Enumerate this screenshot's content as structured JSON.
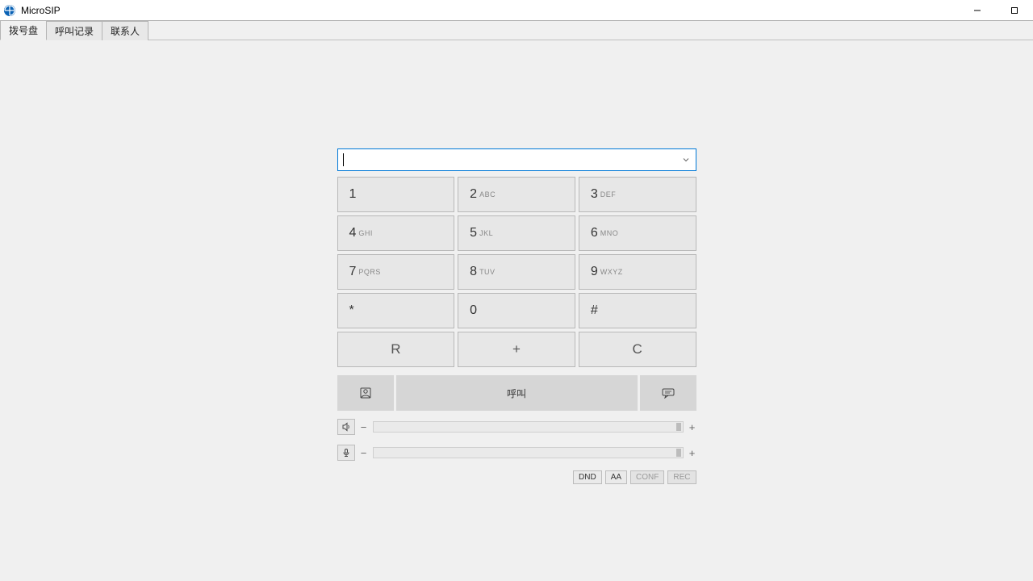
{
  "window": {
    "title": "MicroSIP"
  },
  "tabs": {
    "dialpad": "拨号盘",
    "call_log": "呼叫记录",
    "contacts": "联系人"
  },
  "dialer": {
    "number_value": "",
    "keys": {
      "k1": {
        "digit": "1",
        "letters": ""
      },
      "k2": {
        "digit": "2",
        "letters": "ABC"
      },
      "k3": {
        "digit": "3",
        "letters": "DEF"
      },
      "k4": {
        "digit": "4",
        "letters": "GHI"
      },
      "k5": {
        "digit": "5",
        "letters": "JKL"
      },
      "k6": {
        "digit": "6",
        "letters": "MNO"
      },
      "k7": {
        "digit": "7",
        "letters": "PQRS"
      },
      "k8": {
        "digit": "8",
        "letters": "TUV"
      },
      "k9": {
        "digit": "9",
        "letters": "WXYZ"
      },
      "kstar": {
        "digit": "*",
        "letters": ""
      },
      "k0": {
        "digit": "0",
        "letters": ""
      },
      "khash": {
        "digit": "#",
        "letters": ""
      },
      "kR": {
        "digit": "R"
      },
      "kplus": {
        "digit": "+"
      },
      "kC": {
        "digit": "C"
      }
    },
    "call_label": "呼叫",
    "vol": {
      "minus": "−",
      "plus": "+"
    },
    "toggles": {
      "dnd": "DND",
      "aa": "AA",
      "conf": "CONF",
      "rec": "REC"
    }
  }
}
